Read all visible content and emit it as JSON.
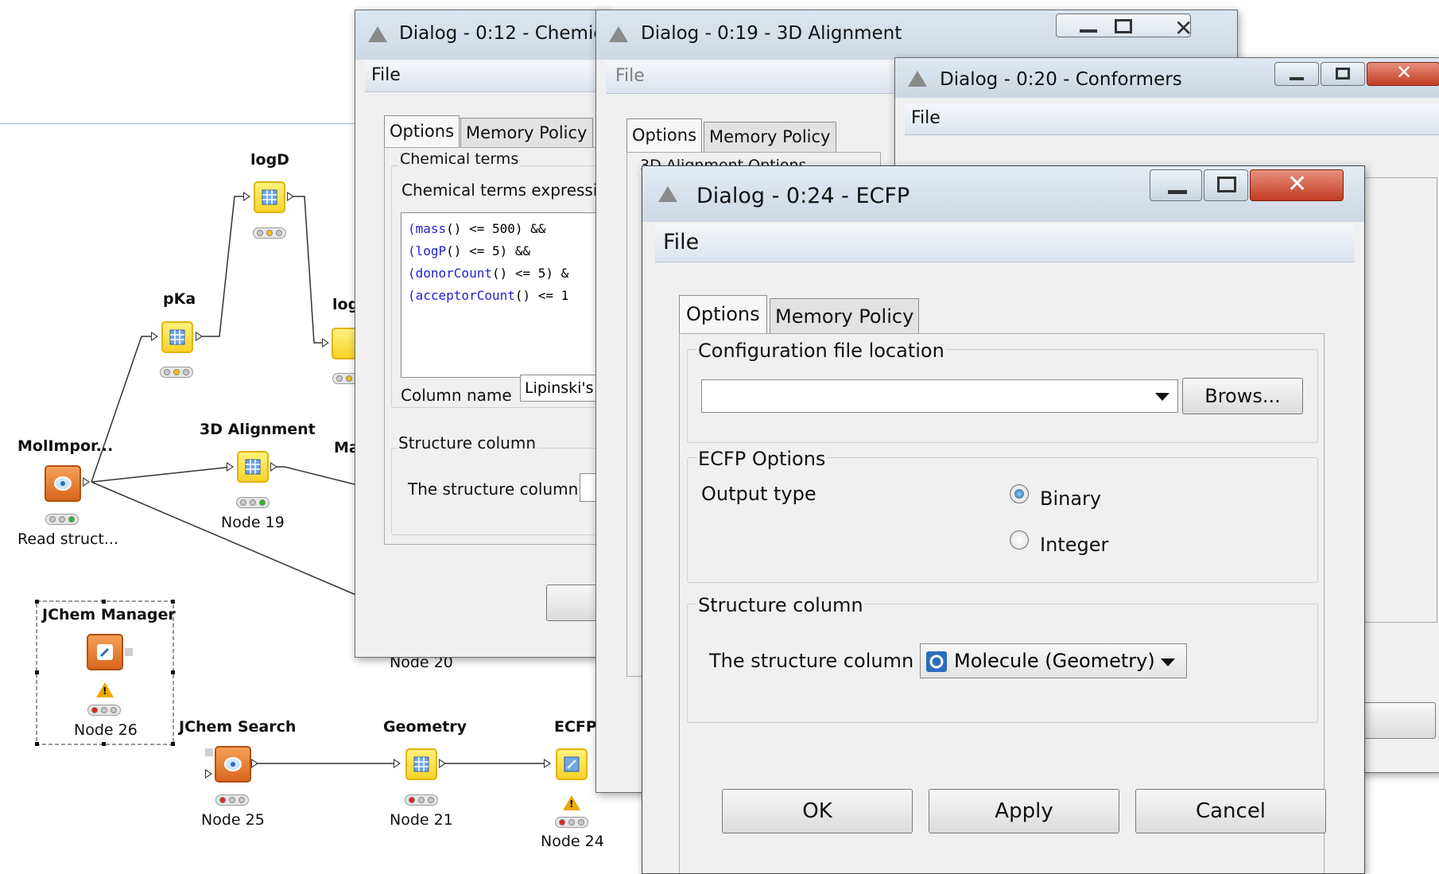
{
  "workflow": {
    "nodes": [
      {
        "title": "logD",
        "label": "",
        "lights": "yellow"
      },
      {
        "title": "pKa",
        "label": "",
        "lights": "yellow"
      },
      {
        "title": "log",
        "label": "",
        "lights": "yellow"
      },
      {
        "title": "MolImpor...",
        "label": "Read struct...",
        "lights": "green"
      },
      {
        "title": "3D Alignment",
        "label": "Node 19",
        "lights": "green"
      },
      {
        "title": "Ma",
        "label": "",
        "lights": ""
      },
      {
        "title": "JChem Manager",
        "label": "Node 26",
        "lights": "red",
        "warning": true
      },
      {
        "title": "JChem Search",
        "label": "Node 25",
        "lights": "red"
      },
      {
        "title": "Geometry",
        "label": "Node 21",
        "lights": "red"
      },
      {
        "title": "ECFP",
        "label": "Node 24",
        "lights": "red",
        "warning": true
      },
      {
        "title": "",
        "label": "Node 20",
        "lights": ""
      }
    ],
    "colors": {
      "yellow": "#f2c400",
      "green": "#2cb52c",
      "red": "#e02020",
      "accent": "#2a6ebb"
    }
  },
  "dialog_chemical": {
    "title": "Dialog - 0:12 - Chemica",
    "menu": "File",
    "tabs": [
      "Options",
      "Memory Policy"
    ],
    "group_chemical_terms": "Chemical terms",
    "expression_label": "Chemical terms expressio",
    "expression_lines": [
      {
        "fn": "(mass",
        "rest": "() <= 500) &&"
      },
      {
        "fn": "(logP",
        "rest": "() <= 5) &&"
      },
      {
        "fn": "(donorCount",
        "rest": "() <= 5) &"
      },
      {
        "fn": "(acceptorCount",
        "rest": "() <= 1"
      }
    ],
    "column_name_label": "Column name",
    "column_name_value": "Lipinski's",
    "group_structure": "Structure column",
    "structure_label": "The structure column"
  },
  "dialog_alignment": {
    "title": "Dialog - 0:19 - 3D Alignment",
    "menu": "File",
    "tabs": [
      "Options",
      "Memory Policy"
    ],
    "group_label": "3D Alignment Options"
  },
  "dialog_conformers": {
    "title": "Dialog - 0:20 - Conformers",
    "menu": "File"
  },
  "dialog_ecfp": {
    "title": "Dialog - 0:24 - ECFP",
    "menu": "File",
    "tabs": [
      "Options",
      "Memory Policy"
    ],
    "group_config": "Configuration file location",
    "config_value": "",
    "browse_button": "Brows...",
    "group_options": "ECFP Options",
    "output_type_label": "Output type",
    "radio_binary": "Binary",
    "radio_integer": "Integer",
    "selected_output": "Binary",
    "group_structure": "Structure column",
    "structure_label": "The structure column",
    "structure_value": "Molecule (Geometry)",
    "ok_button": "OK",
    "apply_button": "Apply",
    "cancel_button": "Cancel"
  }
}
